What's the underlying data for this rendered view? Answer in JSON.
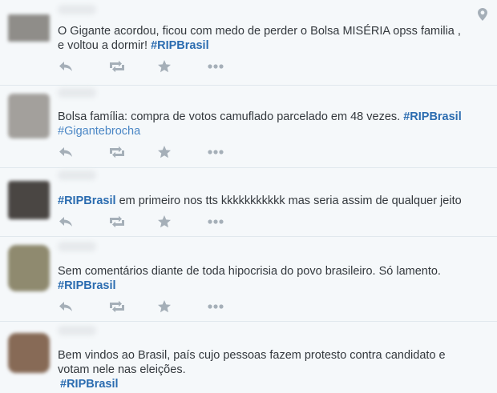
{
  "icons": {
    "reply": "reply-icon",
    "retweet": "retweet-icon",
    "favorite": "star-icon",
    "more": "more-dots-icon",
    "location": "location-pin-icon"
  },
  "colors": {
    "background": "#f5f8fa",
    "hashtag": "#2b6cb0",
    "icon": "#a5afb8",
    "divider": "#e1e8ed"
  },
  "tweets": [
    {
      "line1": "O Gigante acordou, ficou com medo de perder o Bolsa MISÉRIA opss familia ,",
      "line2_prefix": "e voltou a dormir! ",
      "hashtag": "#RIPBrasil"
    },
    {
      "line1_prefix": "Bolsa família: compra de votos camuflado parcelado em 48 vezes. ",
      "hashtag": "#RIPBrasil",
      "hashtag2": "#Gigantebrocha"
    },
    {
      "hashtag": "#RIPBrasil",
      "line1_suffix": " em primeiro nos tts kkkkkkkkkkk mas seria assim de qualquer jeito"
    },
    {
      "line1": "Sem comentários diante de toda hipocrisia do povo brasileiro. Só lamento.",
      "hashtag": "#RIPBrasil"
    },
    {
      "line1": "Bem vindos ao Brasil,  país cujo pessoas fazem protesto contra candidato e",
      "line2": "votam nele nas eleições.",
      "hashtag": "#RIPBrasil"
    }
  ]
}
